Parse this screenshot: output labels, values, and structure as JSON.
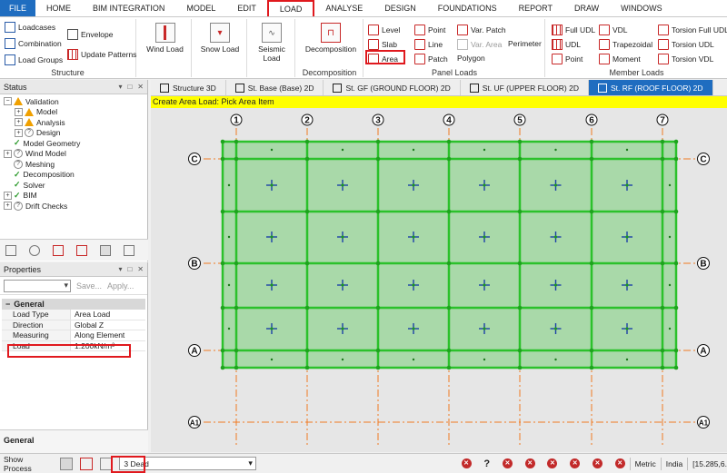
{
  "menubar": {
    "items": [
      "FILE",
      "HOME",
      "BIM INTEGRATION",
      "MODEL",
      "EDIT",
      "LOAD",
      "ANALYSE",
      "DESIGN",
      "FOUNDATIONS",
      "REPORT",
      "DRAW",
      "WINDOWS"
    ],
    "active": "LOAD"
  },
  "ribbon": {
    "structure": {
      "label": "Structure",
      "loadcases": "Loadcases",
      "combination": "Combination",
      "load_groups": "Load Groups",
      "envelope": "Envelope",
      "update_patterns": "Update Patterns"
    },
    "wind_load": "Wind Load",
    "snow_load": "Snow Load",
    "seismic_load": "Seismic Load",
    "decomposition": {
      "button": "Decomposition",
      "label": "Decomposition"
    },
    "panel_loads": {
      "label": "Panel Loads",
      "level": "Level",
      "slab": "Slab",
      "area": "Area",
      "point": "Point",
      "line": "Line",
      "patch": "Patch",
      "var_patch": "Var. Patch",
      "var_area": "Var. Area",
      "polygon": "Polygon",
      "perimeter": "Perimeter"
    },
    "member_loads": {
      "label": "Member Loads",
      "full_udl": "Full UDL",
      "udl": "UDL",
      "point": "Point",
      "vdl": "VDL",
      "trapezoidal": "Trapezoidal",
      "moment": "Moment",
      "torsion_full_udl": "Torsion Full UDL",
      "torsion_udl": "Torsion UDL",
      "torsion_vdl": "Torsion VDL"
    }
  },
  "status_panel": {
    "title": "Status",
    "tree": [
      {
        "label": "Validation",
        "icon": "warning-icon",
        "indent": 0,
        "expander": "−"
      },
      {
        "label": "Model",
        "icon": "warning-icon",
        "indent": 1,
        "expander": "+"
      },
      {
        "label": "Analysis",
        "icon": "warning-icon",
        "indent": 1,
        "expander": "+"
      },
      {
        "label": "Design",
        "icon": "question-icon",
        "indent": 1,
        "expander": "+"
      },
      {
        "label": "Model Geometry",
        "icon": "check-icon",
        "indent": 0,
        "expander": ""
      },
      {
        "label": "Wind Model",
        "icon": "question-icon",
        "indent": 0,
        "expander": "+"
      },
      {
        "label": "Meshing",
        "icon": "question-icon",
        "indent": 0,
        "expander": ""
      },
      {
        "label": "Decomposition",
        "icon": "check-icon",
        "indent": 0,
        "expander": ""
      },
      {
        "label": "Solver",
        "icon": "check-icon",
        "indent": 0,
        "expander": ""
      },
      {
        "label": "BIM",
        "icon": "check-icon",
        "indent": 0,
        "expander": "+"
      },
      {
        "label": "Drift Checks",
        "icon": "question-icon",
        "indent": 0,
        "expander": "+"
      }
    ]
  },
  "properties_panel": {
    "title": "Properties",
    "save": "Save...",
    "apply": "Apply...",
    "group": "General",
    "rows": [
      {
        "key": "Load Type",
        "value": "Area Load"
      },
      {
        "key": "Direction",
        "value": "Global Z"
      },
      {
        "key": "Measuring",
        "value": "Along Element"
      },
      {
        "key": "Load",
        "value": "1.200kN/m²"
      }
    ],
    "footer": "General"
  },
  "tabs": [
    {
      "label": "Structure 3D",
      "active": false
    },
    {
      "label": "St. Base (Base) 2D",
      "active": false
    },
    {
      "label": "St. GF (GROUND FLOOR) 2D",
      "active": false
    },
    {
      "label": "St. UF (UPPER FLOOR) 2D",
      "active": false
    },
    {
      "label": "St. RF (ROOF FLOOR) 2D",
      "active": true
    }
  ],
  "instruction": "Create Area Load: Pick Area Item",
  "grid": {
    "columns": [
      "1",
      "2",
      "3",
      "4",
      "5",
      "6",
      "7"
    ],
    "rows": [
      "C",
      "B",
      "A",
      "A1"
    ]
  },
  "statusbar": {
    "show_process": "Show Process",
    "loadcase": "3 Dead",
    "units": "Metric",
    "region": "India",
    "coords": "[15.285,6."
  },
  "colors": {
    "accent": "#1f6dc0",
    "highlight": "#e0191e",
    "load_fill": "#a9d9a9",
    "beam": "#2bc12b",
    "gridline": "#f07a22"
  }
}
